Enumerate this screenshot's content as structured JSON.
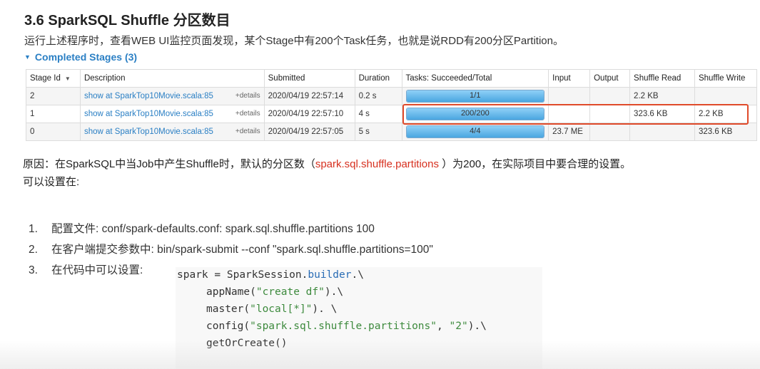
{
  "title": "3.6 SparkSQL Shuffle 分区数目",
  "intro": "运行上述程序时，查看WEB UI监控页面发现，某个Stage中有200个Task任务，也就是说RDD有200分区Partition。",
  "completed_stages_label": "Completed Stages (3)",
  "table": {
    "headers": [
      "Stage Id",
      "Description",
      "Submitted",
      "Duration",
      "Tasks: Succeeded/Total",
      "Input",
      "Output",
      "Shuffle Read",
      "Shuffle Write"
    ],
    "rows": [
      {
        "stage_id": "2",
        "description": "show at SparkTop10Movie.scala:85",
        "details": "+details",
        "submitted": "2020/04/19 22:57:14",
        "duration": "0.2 s",
        "tasks": "1/1",
        "tasks_fraction": 1.0,
        "input": "",
        "output": "",
        "shuffle_read": "2.2 KB",
        "shuffle_write": ""
      },
      {
        "stage_id": "1",
        "description": "show at SparkTop10Movie.scala:85",
        "details": "+details",
        "submitted": "2020/04/19 22:57:10",
        "duration": "4 s",
        "tasks": "200/200",
        "tasks_fraction": 1.0,
        "input": "",
        "output": "",
        "shuffle_read": "323.6 KB",
        "shuffle_write": "2.2 KB"
      },
      {
        "stage_id": "0",
        "description": "show at SparkTop10Movie.scala:85",
        "details": "+details",
        "submitted": "2020/04/19 22:57:05",
        "duration": "5 s",
        "tasks": "4/4",
        "tasks_fraction": 1.0,
        "input": "23.7 ME",
        "output": "",
        "shuffle_read": "",
        "shuffle_write": "323.6 KB"
      }
    ]
  },
  "reason": {
    "prefix": "原因：在SparkSQL中当Job中产生Shuffle时，默认的分区数（",
    "highlight": "spark.sql.shuffle.partitions",
    "suffix": " ）为200，在实际项目中要合理的设置。",
    "line2": "可以设置在:"
  },
  "steps": [
    {
      "num": "1.",
      "text": "配置文件: conf/spark-defaults.conf:    spark.sql.shuffle.partitions 100"
    },
    {
      "num": "2.",
      "text": "在客户端提交参数中: bin/spark-submit --conf \"spark.sql.shuffle.partitions=100\""
    },
    {
      "num": "3.",
      "text": "在代码中可以设置:"
    }
  ],
  "code": {
    "l1_var": "spark",
    "l1_eq": " = ",
    "l1_cls": "SparkSession.",
    "l1_kw": "builder",
    "l1_end": ".\\",
    "l2_fn": "appName(",
    "l2_str": "\"create df\"",
    "l2_end": ").\\",
    "l3_fn": "master(",
    "l3_str": "\"local[*]\"",
    "l3_end": "). \\",
    "l4_fn": "config(",
    "l4_str1": "\"spark.sql.shuffle.partitions\"",
    "l4_sep": ", ",
    "l4_str2": "\"2\"",
    "l4_end": ").\\",
    "l5": "getOrCreate()"
  },
  "colors": {
    "link": "#2a7fc4",
    "highlight_box": "#e04a2a",
    "reason_highlight": "#d7301f",
    "progress_fill": "#4aa6e0"
  }
}
